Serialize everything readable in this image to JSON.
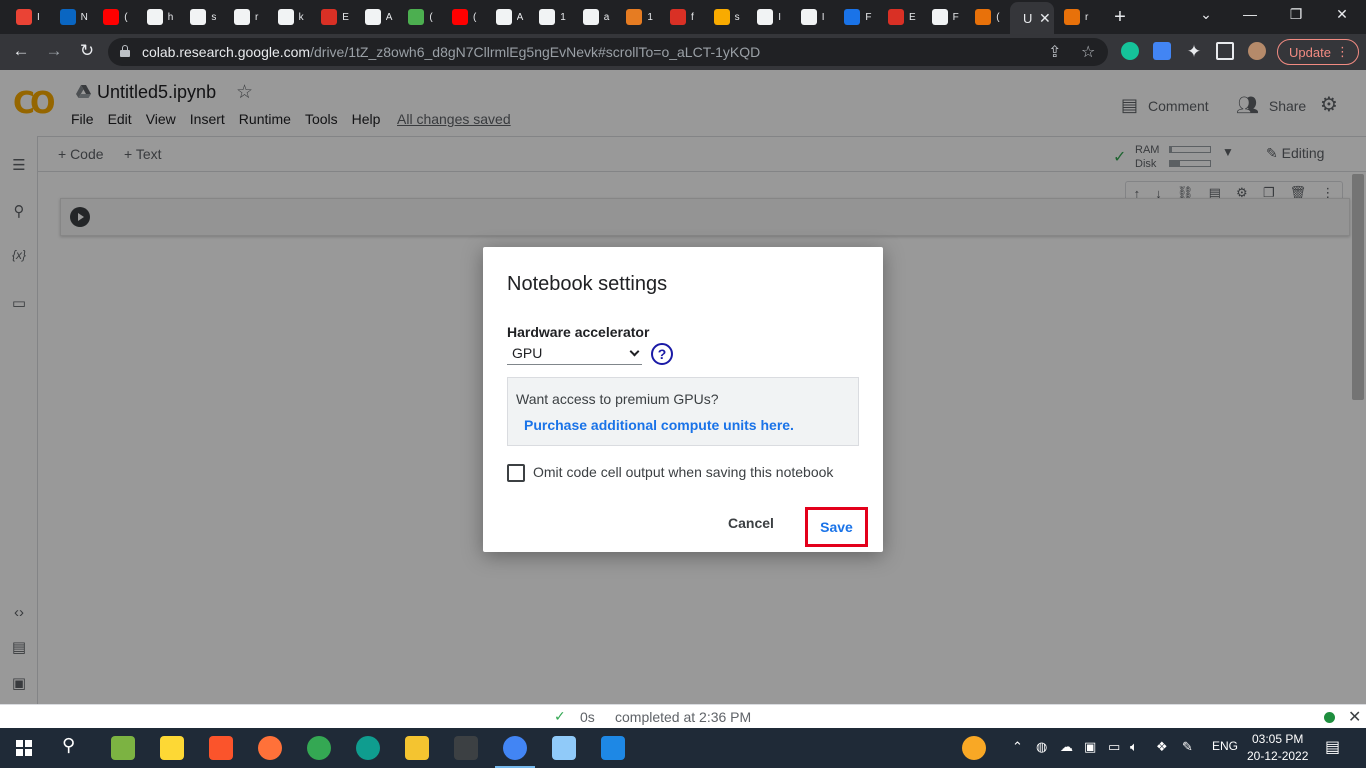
{
  "browser": {
    "tabs": [
      {
        "letter": "I",
        "color": "#ea4335"
      },
      {
        "letter": "N",
        "color": "#0a66c2"
      },
      {
        "letter": "(",
        "color": "#ff0000"
      },
      {
        "letter": "h",
        "color": "#f1f3f4"
      },
      {
        "letter": "s",
        "color": "#f1f3f4"
      },
      {
        "letter": "r",
        "color": "#f1f3f4"
      },
      {
        "letter": "k",
        "color": "#f1f3f4"
      },
      {
        "letter": "E",
        "color": "#d93025"
      },
      {
        "letter": "A",
        "color": "#f1f3f4"
      },
      {
        "letter": "(",
        "color": "#4caf50"
      },
      {
        "letter": "(",
        "color": "#ff0000"
      },
      {
        "letter": "A",
        "color": "#f1f3f4"
      },
      {
        "letter": "1",
        "color": "#f1f3f4"
      },
      {
        "letter": "a",
        "color": "#f1f3f4"
      },
      {
        "letter": "1",
        "color": "#e67c22"
      },
      {
        "letter": "f",
        "color": "#d93025"
      },
      {
        "letter": "s",
        "color": "#f9ab00"
      },
      {
        "letter": "I",
        "color": "#f1f3f4"
      },
      {
        "letter": "I",
        "color": "#f1f3f4"
      },
      {
        "letter": "F",
        "color": "#1a73e8"
      },
      {
        "letter": "E",
        "color": "#d93025"
      },
      {
        "letter": "F",
        "color": "#f1f3f4"
      },
      {
        "letter": "(",
        "color": "#e8710a"
      }
    ],
    "active_tab": {
      "letter": "U"
    },
    "last_tab": {
      "letter": "r"
    },
    "url_host": "colab.research.google.com",
    "url_path": "/drive/1tZ_z8owh6_d8gN7CllrmlEg5ngEvNevk#scrollTo=o_aLCT-1yKQD",
    "update_label": "Update"
  },
  "colab": {
    "logo": "CO",
    "notebook_title": "Untitled5.ipynb",
    "menu": [
      "File",
      "Edit",
      "View",
      "Insert",
      "Runtime",
      "Tools",
      "Help"
    ],
    "save_status": "All changes saved",
    "comment_label": "Comment",
    "share_label": "Share",
    "add_code": "+ Code",
    "add_text": "+ Text",
    "ram_label": "RAM",
    "disk_label": "Disk",
    "ram_fraction": 0.05,
    "disk_fraction": 0.25,
    "editing_label": "Editing"
  },
  "dialog": {
    "title": "Notebook settings",
    "hardware_label": "Hardware accelerator",
    "hardware_value": "GPU",
    "help_glyph": "?",
    "promo_text": "Want access to premium GPUs?",
    "promo_link": "Purchase additional compute units here.",
    "omit_label": "Omit code cell output when saving this notebook",
    "omit_checked": false,
    "cancel_label": "Cancel",
    "save_label": "Save"
  },
  "status": {
    "time": "0s",
    "completed": "completed at 2:36 PM"
  },
  "taskbar": {
    "lang": "ENG",
    "time": "03:05 PM",
    "date": "20-12-2022"
  },
  "colors": {
    "accent": "#1a73e8",
    "highlight_box": "#e3001b",
    "colab_orange": "#f9ab00"
  }
}
